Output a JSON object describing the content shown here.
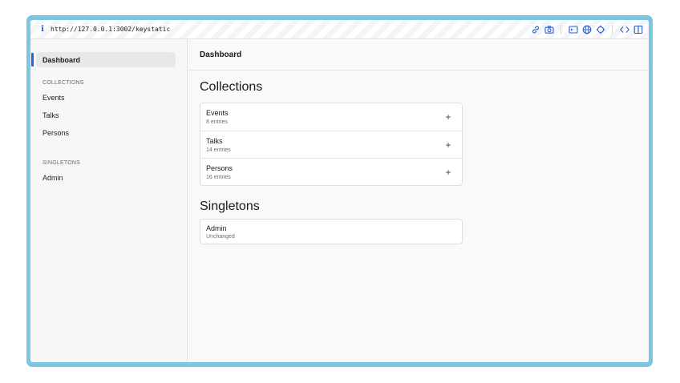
{
  "browser": {
    "url": "http://127.0.0.1:3002/keystatic",
    "info_glyph": "i",
    "toolbar_icons": [
      "link-icon",
      "camera-icon",
      "terminal-icon",
      "globe-icon",
      "crosshair-icon",
      "code-icon",
      "split-panel-icon"
    ]
  },
  "sidebar": {
    "dashboard_label": "Dashboard",
    "collections_heading": "COLLECTIONS",
    "collections": [
      {
        "label": "Events"
      },
      {
        "label": "Talks"
      },
      {
        "label": "Persons"
      }
    ],
    "singletons_heading": "SINGLETONS",
    "singletons": [
      {
        "label": "Admin"
      }
    ]
  },
  "main": {
    "header_title": "Dashboard",
    "collections_heading": "Collections",
    "collections": [
      {
        "name": "Events",
        "entries": "8 entries",
        "add_glyph": "+"
      },
      {
        "name": "Talks",
        "entries": "14 entries",
        "add_glyph": "+"
      },
      {
        "name": "Persons",
        "entries": "16 entries",
        "add_glyph": "+"
      }
    ],
    "singletons_heading": "Singletons",
    "singletons": [
      {
        "name": "Admin",
        "status": "Unchanged"
      }
    ]
  },
  "colors": {
    "frame": "#7cc6e4",
    "accent": "#2e60d8",
    "sidebar_bg": "#f7f7f7",
    "main_bg": "#f9f9f9"
  }
}
